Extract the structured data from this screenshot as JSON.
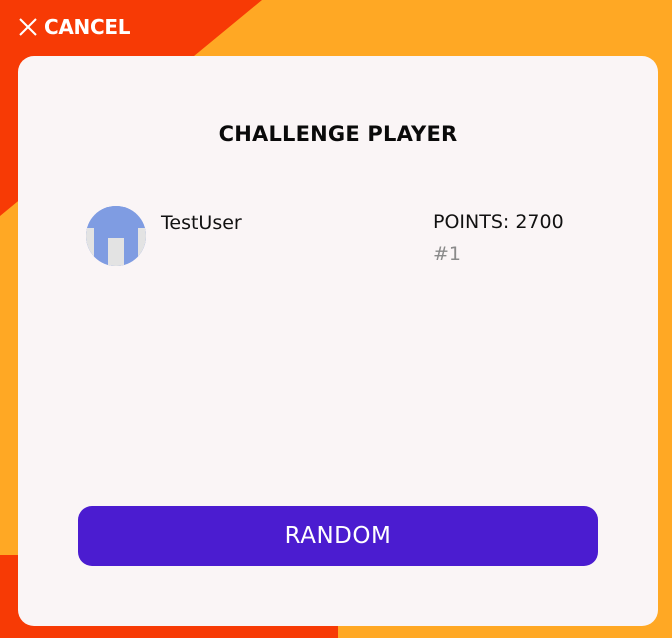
{
  "header": {
    "cancel_label": "CANCEL",
    "cancel_icon": "close-icon"
  },
  "dialog": {
    "title": "CHALLENGE PLAYER",
    "players": [
      {
        "username": "TestUser",
        "points_label": "POINTS: 2700",
        "rank": "#1",
        "avatar_icon": "pixel-avatar-icon"
      }
    ],
    "random_button_label": "RANDOM"
  },
  "colors": {
    "background_orange": "#FFA824",
    "background_red": "#F73A05",
    "card_background": "#FAF5F6",
    "button_purple": "#4B1CD0",
    "avatar_blue": "#7F9CE2",
    "rank_gray": "#8A8A8A"
  }
}
